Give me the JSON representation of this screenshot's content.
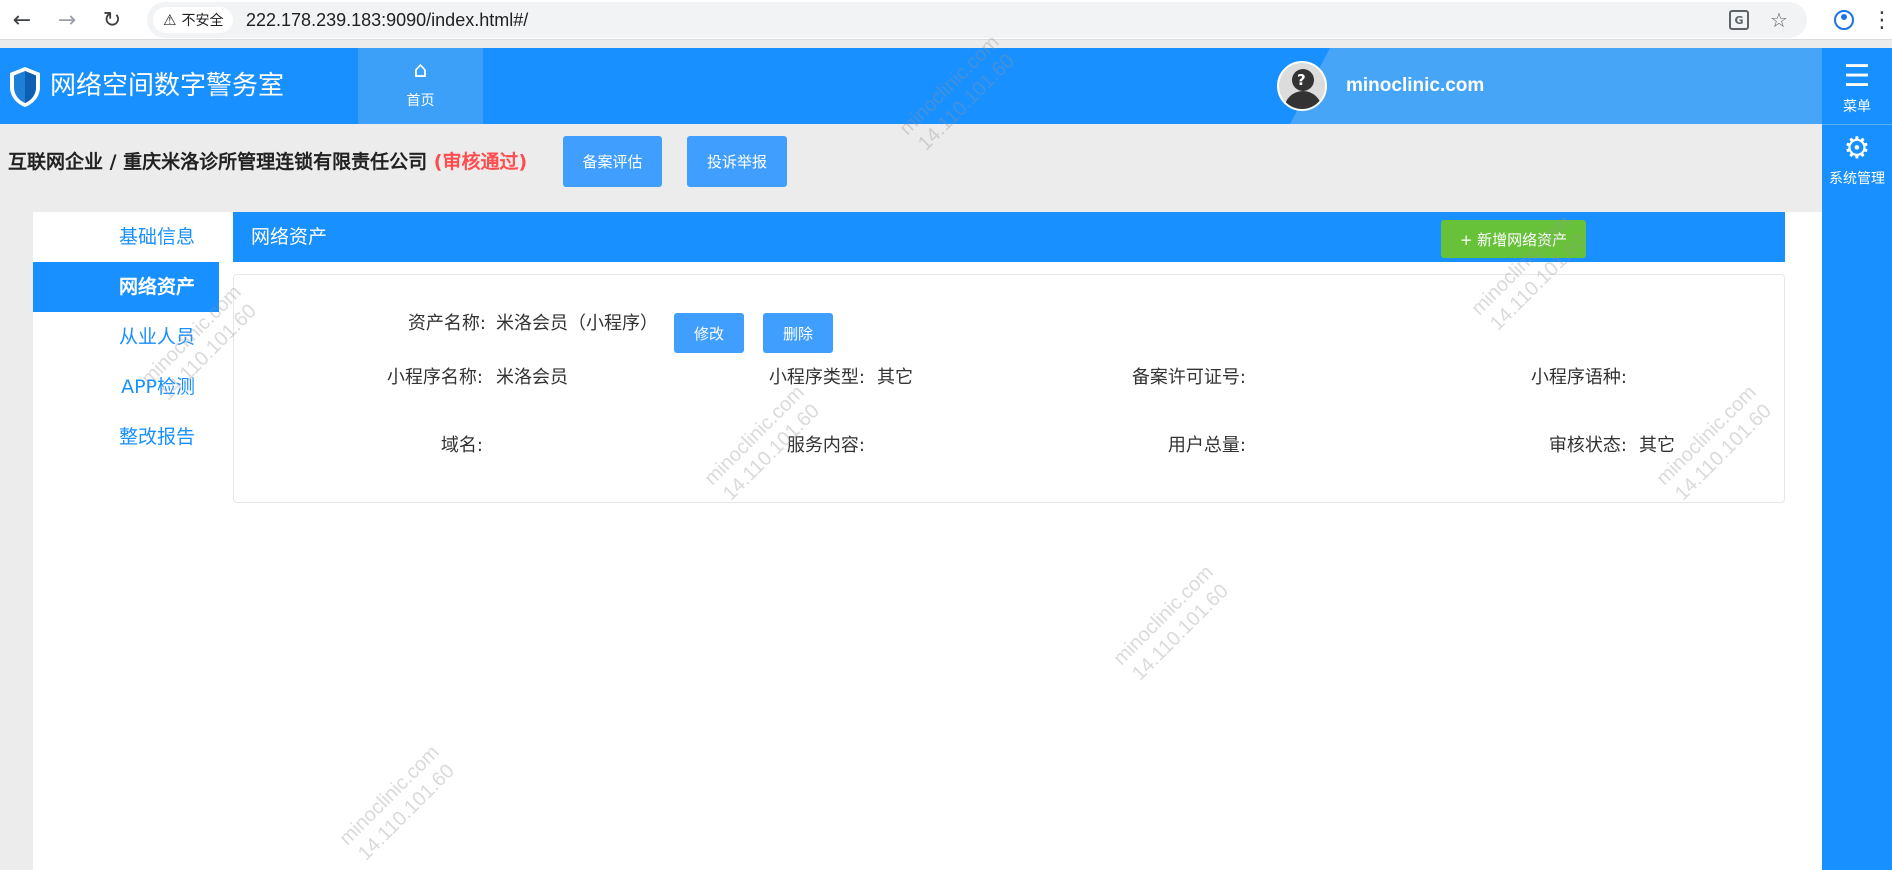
{
  "browser": {
    "security_label": "不安全",
    "url": "222.178.239.183:9090/index.html#/"
  },
  "header": {
    "app_title": "网络空间数字警务室",
    "home_tab_label": "首页",
    "username": "minoclinic.com"
  },
  "right_bar": {
    "menu_label": "菜单",
    "system_label": "系统管理"
  },
  "company": {
    "path": "互联网企业 / 重庆米洛诊所管理连锁有限责任公司",
    "status": "(审核通过)",
    "btn_filing_eval": "备案评估",
    "btn_complaint": "投诉举报"
  },
  "side_menu": {
    "items": [
      {
        "label": "基础信息"
      },
      {
        "label": "网络资产"
      },
      {
        "label": "从业人员"
      },
      {
        "label": "APP检测"
      },
      {
        "label": "整改报告"
      }
    ]
  },
  "panel": {
    "title": "网络资产",
    "add_button": "+ 新增网络资产"
  },
  "asset": {
    "name_label": "资产名称:",
    "name_value": "米洛会员（小程序）",
    "edit_button": "修改",
    "delete_button": "删除",
    "fields": {
      "miniapp_name_label": "小程序名称:",
      "miniapp_name_value": "米洛会员",
      "miniapp_type_label": "小程序类型:",
      "miniapp_type_value": "其它",
      "license_label": "备案许可证号:",
      "license_value": "",
      "language_label": "小程序语种:",
      "language_value": "",
      "domain_label": "域名:",
      "domain_value": "",
      "service_label": "服务内容:",
      "service_value": "",
      "users_label": "用户总量:",
      "users_value": "",
      "review_label": "审核状态:",
      "review_value": "其它"
    }
  },
  "watermark": {
    "line1": "minoclinic.com",
    "line2": "14.110.101.60"
  }
}
